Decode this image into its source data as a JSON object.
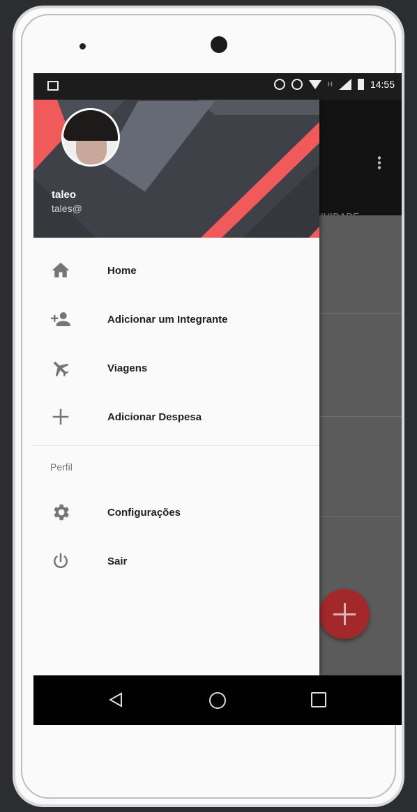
{
  "status_bar": {
    "time": "14:55",
    "network": "H"
  },
  "drawer": {
    "user_name": "taleo",
    "user_email": "tales@",
    "items": [
      {
        "label": "Home",
        "icon": "home-icon"
      },
      {
        "label": "Adicionar um Integrante",
        "icon": "add-person-icon"
      },
      {
        "label": "Viagens",
        "icon": "airplane-icon"
      },
      {
        "label": "Adicionar Despesa",
        "icon": "plus-icon"
      }
    ],
    "section_title": "Perfil",
    "profile_items": [
      {
        "label": "Configurações",
        "icon": "gear-icon"
      },
      {
        "label": "Sair",
        "icon": "power-icon"
      }
    ]
  },
  "background_app": {
    "tab_label": "IVIDADE"
  },
  "colors": {
    "accent": "#f44336",
    "header": "#3f4148",
    "fab": "#a3282a"
  }
}
